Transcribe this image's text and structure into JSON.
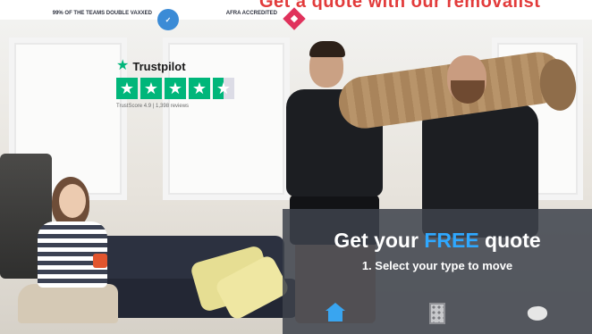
{
  "header": {
    "cut_text": "Get a quote with our removalist"
  },
  "badges": [
    {
      "text": "99% of the teams double vaxxed",
      "icon": "circle-check-icon",
      "icon_text": "✓",
      "color": "#3b8bd6"
    },
    {
      "text": "AFRA accredited",
      "icon": "diamond-icon",
      "color": "#e0325c"
    }
  ],
  "trustpilot": {
    "name": "Trustpilot",
    "stars": 4.5,
    "note": "TrustScore 4.9 | 1,398 reviews",
    "color": "#00b67a"
  },
  "quote": {
    "title_prefix": "Get your",
    "title_highlight": "FREE",
    "title_suffix": "quote",
    "step": "1. Select your type to move",
    "options": [
      {
        "icon": "house-icon",
        "selected": true
      },
      {
        "icon": "building-icon",
        "selected": false
      },
      {
        "icon": "australia-map-icon",
        "selected": false
      }
    ],
    "highlight_color": "#2fa8ff"
  }
}
